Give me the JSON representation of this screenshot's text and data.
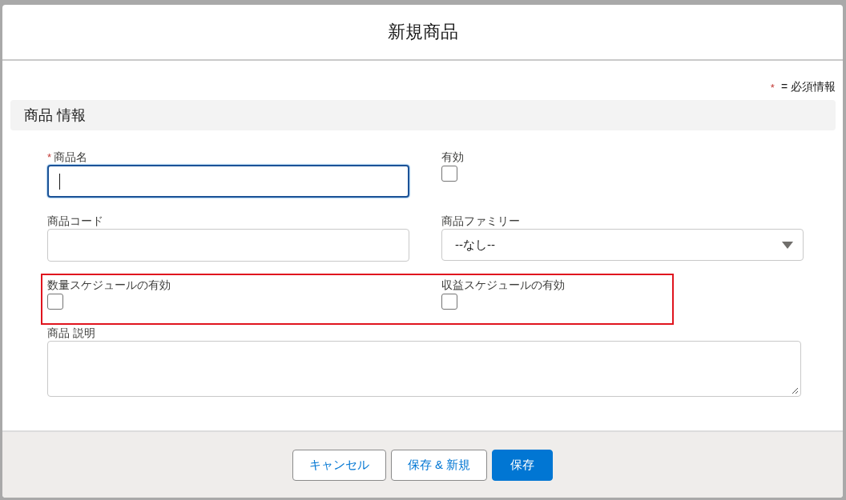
{
  "modal": {
    "title": "新規商品"
  },
  "required_note": {
    "marker": "*",
    "text": "= 必須情報"
  },
  "section": {
    "title": "商品 情報"
  },
  "rows": [
    {
      "fields": [
        {
          "kind": "text",
          "label": "商品名",
          "required_mark": "*",
          "focused": true
        },
        {
          "kind": "checkbox",
          "label": "有効",
          "checked": false
        }
      ]
    },
    {
      "fields": [
        {
          "kind": "text",
          "label": "商品コード",
          "focused": false
        },
        {
          "kind": "select",
          "label": "商品ファミリー",
          "value": "--なし--"
        }
      ]
    },
    {
      "highlighted": true,
      "fields": [
        {
          "kind": "checkbox",
          "label": "数量スケジュールの有効",
          "checked": false
        },
        {
          "kind": "checkbox",
          "label": "収益スケジュールの有効",
          "checked": false
        }
      ]
    },
    {
      "fields": [
        {
          "kind": "textarea",
          "label": "商品 説明"
        }
      ]
    }
  ],
  "buttons": [
    {
      "label": "キャンセル",
      "primary": false
    },
    {
      "label": "保存 & 新規",
      "primary": false
    },
    {
      "label": "保存",
      "primary": true
    }
  ]
}
